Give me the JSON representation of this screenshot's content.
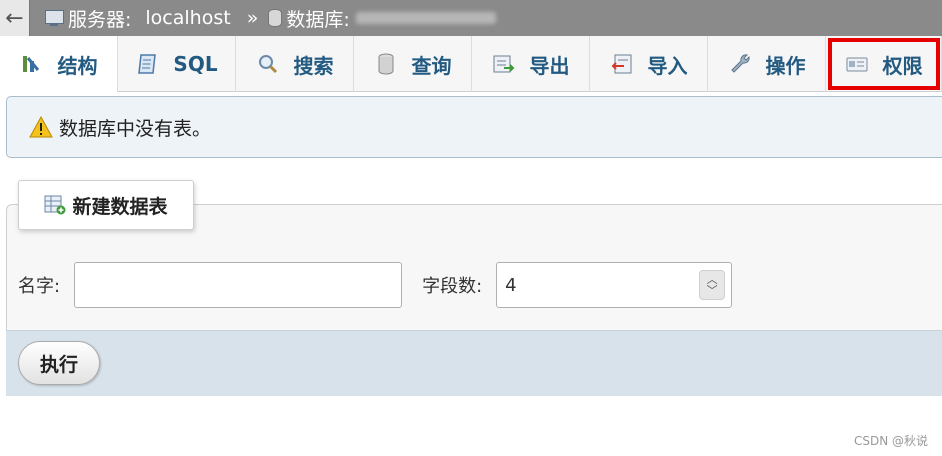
{
  "breadcrumb": {
    "back_glyph": "←",
    "server_label": "服务器:",
    "server_value": "localhost",
    "separator": "»",
    "database_label": "数据库:"
  },
  "tabs": [
    {
      "label": "结构",
      "icon": "structure-icon"
    },
    {
      "label": "SQL",
      "icon": "sql-icon"
    },
    {
      "label": "搜索",
      "icon": "search-icon"
    },
    {
      "label": "查询",
      "icon": "query-icon"
    },
    {
      "label": "导出",
      "icon": "export-icon"
    },
    {
      "label": "导入",
      "icon": "import-icon"
    },
    {
      "label": "操作",
      "icon": "wrench-icon"
    },
    {
      "label": "权限",
      "icon": "privileges-icon"
    }
  ],
  "notice": {
    "text": "数据库中没有表。",
    "icon": "warning-icon"
  },
  "create_table": {
    "legend": "新建数据表",
    "name_label": "名字:",
    "name_value": "",
    "columns_label": "字段数:",
    "columns_value": "4",
    "submit_label": "执行"
  },
  "watermark": "CSDN @秋说",
  "colors": {
    "tab_text": "#235a81",
    "highlight": "#e60000",
    "topbar": "#8a8a8a"
  }
}
